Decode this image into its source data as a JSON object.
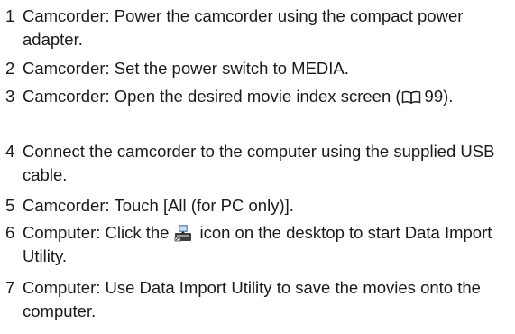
{
  "steps": [
    {
      "number": "1",
      "text": "Camcorder: Power the camcorder using the compact power adapter."
    },
    {
      "number": "2",
      "text": "Camcorder: Set the power switch to MEDIA."
    },
    {
      "number": "3",
      "text_before": "Camcorder: Open the desired movie index screen (",
      "page_ref": "99",
      "text_after": ").",
      "ref_icon": "book-icon"
    },
    {
      "number": "4",
      "text": "Connect the camcorder to the computer using the supplied USB cable."
    },
    {
      "number": "5",
      "text": "Camcorder: Touch [All (for PC only)]."
    },
    {
      "number": "6",
      "text_before": "Computer: Click the",
      "icon": "data-import-utility-icon",
      "text_after": "icon on the desktop to start Data Import Utility."
    },
    {
      "number": "7",
      "text": "Computer: Use Data Import Utility to save the movies onto the computer."
    }
  ]
}
